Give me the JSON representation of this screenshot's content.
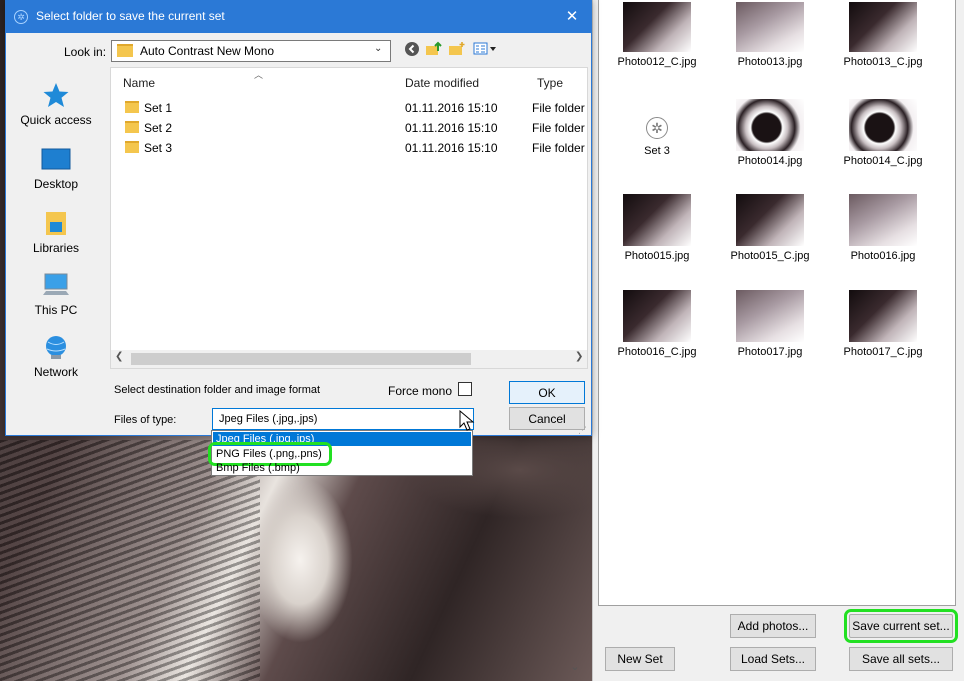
{
  "dialog": {
    "title": "Select folder to save the current set",
    "close_symbol": "✕",
    "lookin_label": "Look in:",
    "lookin_value": "Auto Contrast New Mono",
    "toolbar_icons": [
      "back-icon",
      "up-folder-icon",
      "new-folder-icon",
      "view-menu-icon"
    ],
    "places": [
      {
        "label": "Quick access",
        "icon": "star-icon"
      },
      {
        "label": "Desktop",
        "icon": "desktop-icon"
      },
      {
        "label": "Libraries",
        "icon": "libraries-icon"
      },
      {
        "label": "This PC",
        "icon": "computer-icon"
      },
      {
        "label": "Network",
        "icon": "network-icon"
      }
    ],
    "columns": {
      "name": "Name",
      "date": "Date modified",
      "type": "Type"
    },
    "files": [
      {
        "name": "Set 1",
        "date": "01.11.2016 15:10",
        "type": "File folder"
      },
      {
        "name": "Set 2",
        "date": "01.11.2016 15:10",
        "type": "File folder"
      },
      {
        "name": "Set 3",
        "date": "01.11.2016 15:10",
        "type": "File folder"
      }
    ],
    "dest_label": "Select destination folder and image format",
    "force_mono_label": "Force mono",
    "force_mono_checked": false,
    "ok_label": "OK",
    "cancel_label": "Cancel",
    "filetype_label": "Files of type:",
    "filetype_value": "Jpeg Files (.jpg,.jps)",
    "filetype_options": [
      "Jpeg Files (.jpg,.jps)",
      "PNG Files (.png,.pns)",
      "Bmp Files (.bmp)"
    ]
  },
  "thumbnails": [
    {
      "label": "Photo012_C.jpg",
      "style": "c"
    },
    {
      "label": "Photo013.jpg",
      "style": "light"
    },
    {
      "label": "Photo013_C.jpg",
      "style": "c"
    },
    {
      "label": "Set 3",
      "style": "set"
    },
    {
      "label": "Photo014.jpg",
      "style": "ring"
    },
    {
      "label": "Photo014_C.jpg",
      "style": "ring"
    },
    {
      "label": "Photo015.jpg",
      "style": "c"
    },
    {
      "label": "Photo015_C.jpg",
      "style": "c"
    },
    {
      "label": "Photo016.jpg",
      "style": "light"
    },
    {
      "label": "Photo016_C.jpg",
      "style": "c"
    },
    {
      "label": "Photo017.jpg",
      "style": "light"
    },
    {
      "label": "Photo017_C.jpg",
      "style": "c"
    }
  ],
  "buttons": {
    "add_photos": "Add photos...",
    "save_current_set": "Save current set...",
    "new_set": "New Set",
    "load_sets": "Load Sets...",
    "save_all_sets": "Save all sets..."
  },
  "colors": {
    "accent": "#2b79d6",
    "highlight": "#22e022",
    "selection": "#0078d7"
  }
}
